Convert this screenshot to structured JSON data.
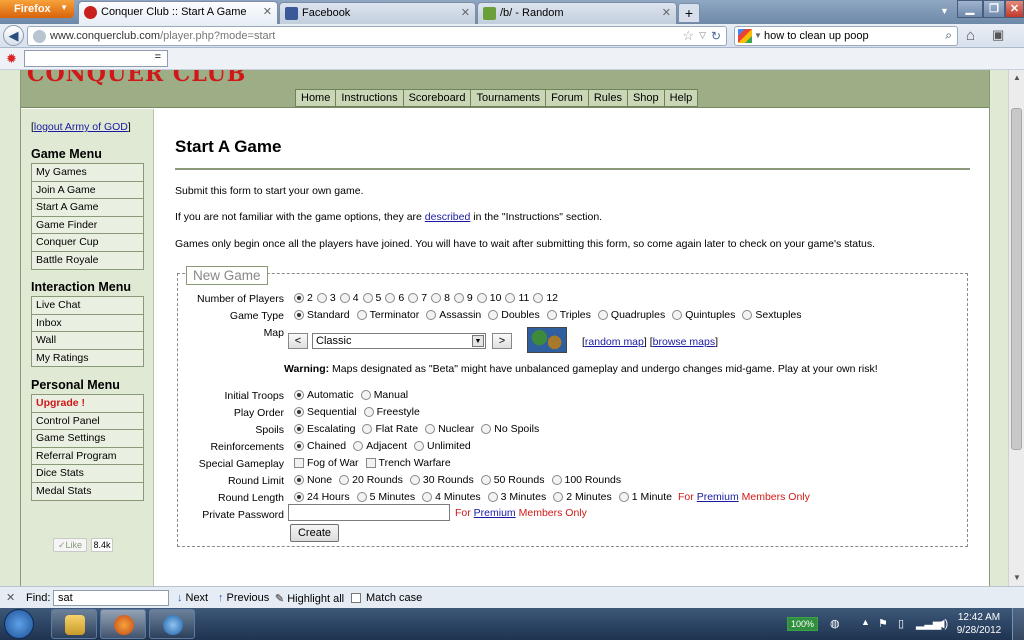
{
  "browser": {
    "app_button": "Firefox",
    "tabs": [
      {
        "title": "Conquer Club :: Start A Game",
        "active": true
      },
      {
        "title": "Facebook",
        "active": false
      },
      {
        "title": "/b/ - Random",
        "active": false
      }
    ],
    "new_tab": "+",
    "url_prefix": "www.conquerclub.com",
    "url_path": "/player.php?mode=start",
    "search_query": "how to clean up poop",
    "toolbar_input": "="
  },
  "site": {
    "logo_text": "CONQUER CLUB",
    "nav": [
      "Home",
      "Instructions",
      "Scoreboard",
      "Tournaments",
      "Forum",
      "Rules",
      "Shop",
      "Help"
    ],
    "logout_prefix": "[",
    "logout_text": "logout Army of GOD",
    "logout_suffix": "]",
    "game_menu": {
      "title": "Game Menu",
      "items": [
        "My Games",
        "Join A Game",
        "Start A Game",
        "Game Finder",
        "Conquer Cup",
        "Battle Royale"
      ]
    },
    "interaction_menu": {
      "title": "Interaction Menu",
      "items": [
        "Live Chat",
        "Inbox",
        "Wall",
        "My Ratings"
      ]
    },
    "personal_menu": {
      "title": "Personal Menu",
      "items": [
        "Upgrade !",
        "Control Panel",
        "Game Settings",
        "Referral Program",
        "Dice Stats",
        "Medal Stats"
      ]
    },
    "like_label": "Like",
    "like_count": "8.4k"
  },
  "content": {
    "title": "Start A Game",
    "p1": "Submit this form to start your own game.",
    "p2_before": "If you are not familiar with the game options, they are ",
    "p2_link": "described",
    "p2_after": " in the \"Instructions\" section.",
    "p3": "Games only begin once all the players have joined. You will have to wait after submitting this form, so come again later to check on your game's status.",
    "legend": "New Game",
    "players": {
      "label": "Number of Players",
      "options": [
        "2",
        "3",
        "4",
        "5",
        "6",
        "7",
        "8",
        "9",
        "10",
        "11",
        "12"
      ],
      "selected": 0
    },
    "game_type": {
      "label": "Game Type",
      "options": [
        "Standard",
        "Terminator",
        "Assassin",
        "Doubles",
        "Triples",
        "Quadruples",
        "Quintuples",
        "Sextuples"
      ],
      "selected": 0
    },
    "map": {
      "label": "Map",
      "value": "Classic",
      "prev": "<",
      "next": ">",
      "random_link": "random map",
      "browse_link": "browse maps"
    },
    "warning_bold": "Warning:",
    "warning_text": " Maps designated as \"Beta\" might have unbalanced gameplay and undergo changes mid-game. Play at your own risk!",
    "initial_troops": {
      "label": "Initial Troops",
      "options": [
        "Automatic",
        "Manual"
      ],
      "selected": 0
    },
    "play_order": {
      "label": "Play Order",
      "options": [
        "Sequential",
        "Freestyle"
      ],
      "selected": 0
    },
    "spoils": {
      "label": "Spoils",
      "options": [
        "Escalating",
        "Flat Rate",
        "Nuclear",
        "No Spoils"
      ],
      "selected": 0
    },
    "reinforcements": {
      "label": "Reinforcements",
      "options": [
        "Chained",
        "Adjacent",
        "Unlimited"
      ],
      "selected": 0
    },
    "special": {
      "label": "Special Gameplay",
      "options": [
        "Fog of War",
        "Trench Warfare"
      ]
    },
    "round_limit": {
      "label": "Round Limit",
      "options": [
        "None",
        "20 Rounds",
        "30 Rounds",
        "50 Rounds",
        "100 Rounds"
      ],
      "selected": 0
    },
    "round_length": {
      "label": "Round Length",
      "options": [
        "24 Hours",
        "5 Minutes",
        "4 Minutes",
        "3 Minutes",
        "2 Minutes",
        "1 Minute"
      ],
      "selected": 0
    },
    "premium_for": "For ",
    "premium_link": "Premium",
    "premium_after": " Members Only",
    "password_label": "Private Password",
    "create_button": "Create"
  },
  "findbar": {
    "label": "Find:",
    "value": "sat",
    "next": "Next",
    "previous": "Previous",
    "highlight": "Highlight all",
    "match_case": "Match case"
  },
  "taskbar": {
    "battery": "100%",
    "time": "12:42 AM",
    "date": "9/28/2012"
  }
}
